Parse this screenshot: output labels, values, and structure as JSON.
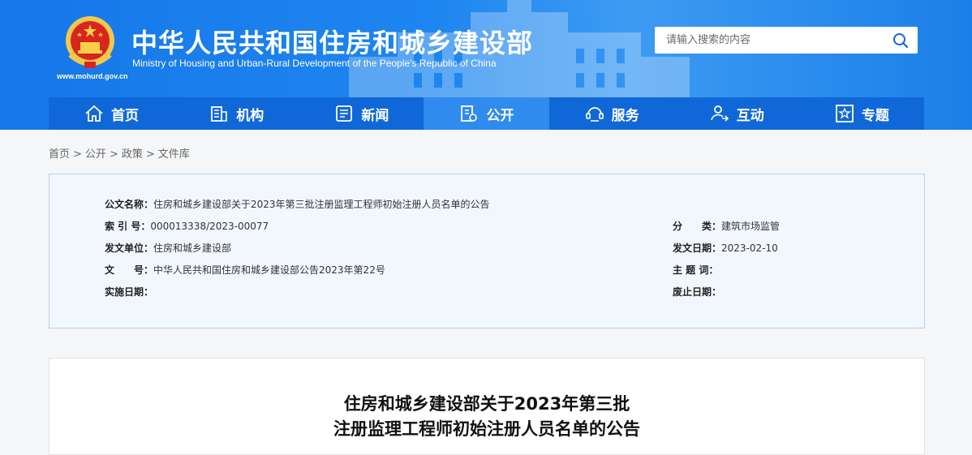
{
  "header": {
    "title_cn": "中华人民共和国住房和城乡建设部",
    "title_en": "Ministry of Housing and Urban-Rural Development of the People's Republic of China",
    "site_url": "www.mohurd.gov.cn",
    "search_placeholder": "请输入搜索的内容",
    "colors": {
      "banner": "#1677e8",
      "nav": "#1068d8",
      "nav_active": "#2f8bee"
    }
  },
  "nav": {
    "items": [
      {
        "label": "首页",
        "icon": "home-icon"
      },
      {
        "label": "机构",
        "icon": "building-icon"
      },
      {
        "label": "新闻",
        "icon": "news-icon"
      },
      {
        "label": "公开",
        "icon": "document-icon",
        "active": true
      },
      {
        "label": "服务",
        "icon": "service-icon"
      },
      {
        "label": "互动",
        "icon": "interact-icon"
      },
      {
        "label": "专题",
        "icon": "star-icon"
      }
    ]
  },
  "breadcrumb": [
    "首页",
    "公开",
    "政策",
    "文件库"
  ],
  "info": {
    "title_label": "公文名称：",
    "title_value": "住房和城乡建设部关于2023年第三批注册监理工程师初始注册人员名单的公告",
    "index_label": "索 引 号：",
    "index_value": "000013338/2023-00077",
    "category_label": "分　　类：",
    "category_value": "建筑市场监管",
    "issuer_label": "发文单位：",
    "issuer_value": "住房和城乡建设部",
    "date_label": "发文日期：",
    "date_value": "2023-02-10",
    "docno_label": "文　　号：",
    "docno_value": "中华人民共和国住房和城乡建设部公告2023年第22号",
    "subject_label": "主 题 词：",
    "subject_value": "",
    "effective_label": "实施日期：",
    "effective_value": "",
    "repeal_label": "废止日期：",
    "repeal_value": ""
  },
  "article": {
    "title_line1": "住房和城乡建设部关于2023年第三批",
    "title_line2": "注册监理工程师初始注册人员名单的公告"
  }
}
